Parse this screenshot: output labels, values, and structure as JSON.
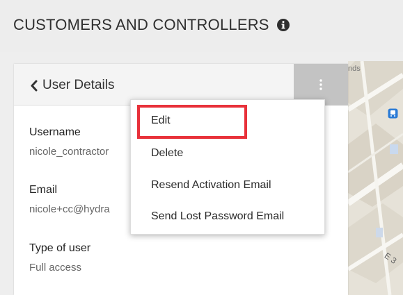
{
  "page": {
    "title": "CUSTOMERS AND CONTROLLERS",
    "info_icon": "info-circle-icon"
  },
  "card": {
    "header": {
      "back_label": "User Details",
      "back_icon": "chevron-left-icon",
      "menu_icon": "kebab-vertical-icon"
    },
    "fields": [
      {
        "label": "Username",
        "value": "nicole_contractor"
      },
      {
        "label": "Email",
        "value": "nicole+cc@hydra"
      },
      {
        "label": "Type of user",
        "value": "Full access"
      }
    ]
  },
  "dropdown": {
    "items": [
      {
        "label": "Edit",
        "highlighted": true
      },
      {
        "label": "Delete"
      },
      {
        "label": "Resend Activation Email"
      },
      {
        "label": "Send Lost Password Email"
      }
    ],
    "highlight_color": "#e8313a"
  },
  "map": {
    "fragment_text": "nds",
    "street_fragment": "E 3"
  },
  "colors": {
    "menu_button_bg": "#c3c3c3",
    "header_bg": "#f4f4f4",
    "transit_icon": "#2b7bd6"
  }
}
